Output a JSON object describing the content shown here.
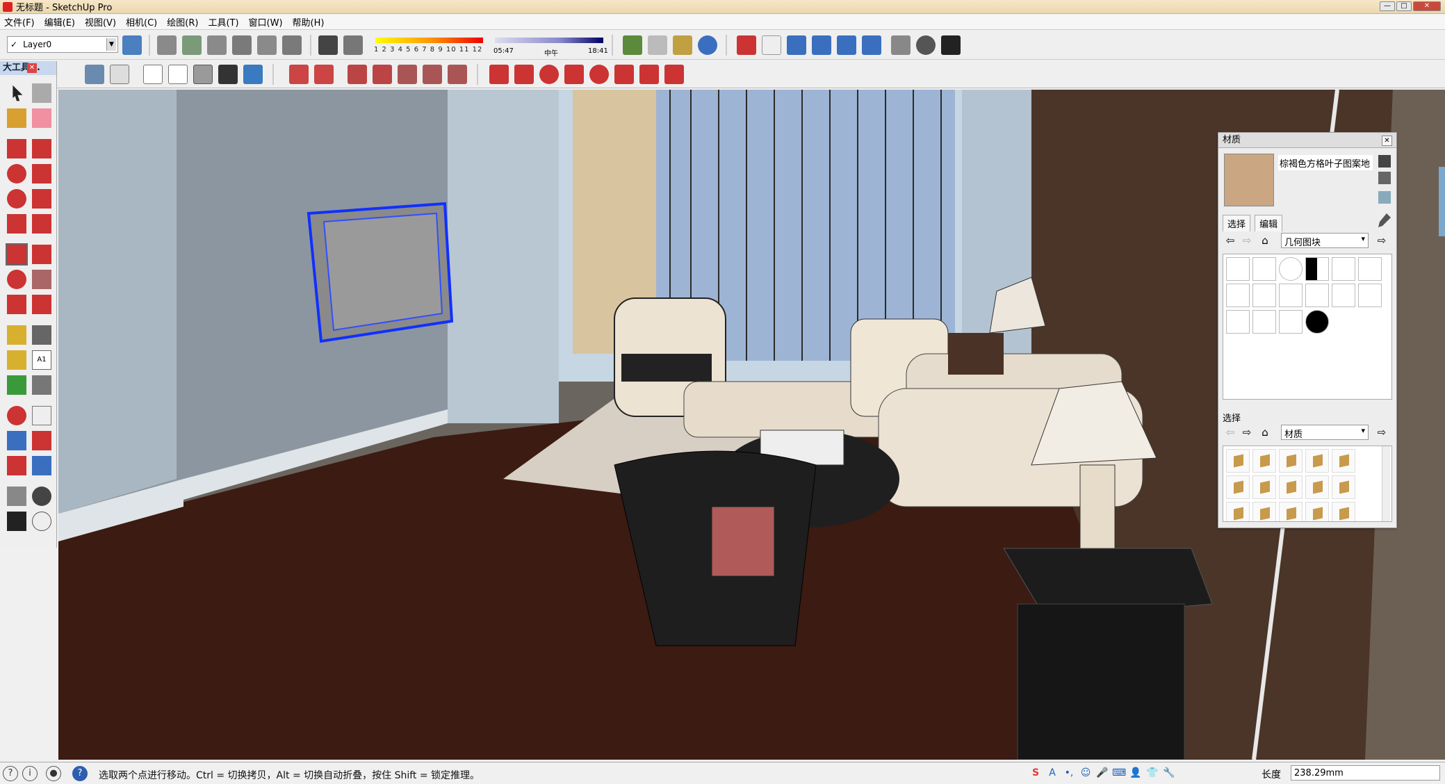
{
  "window": {
    "title": "无标题 - SketchUp Pro"
  },
  "menu": [
    "文件(F)",
    "编辑(E)",
    "视图(V)",
    "相机(C)",
    "绘图(R)",
    "工具(T)",
    "窗口(W)",
    "帮助(H)"
  ],
  "layer": {
    "current": "Layer0"
  },
  "shadow": {
    "month_ticks": "1 2 3 4 5 6 7 8 9 10 11 12",
    "time_start": "05:47",
    "time_mid": "中午",
    "time_end": "18:41"
  },
  "toolpanel": {
    "title": "大工具..."
  },
  "materials": {
    "panel_title": "材质",
    "current_name": "棕褐色方格叶子图案地",
    "tabs": [
      "选择",
      "编辑"
    ],
    "collection1": "几何图块",
    "section2_label": "选择",
    "collection2": "材质",
    "swatch_color": "#caa683"
  },
  "status": {
    "hint": "选取两个点进行移动。Ctrl = 切换拷贝，Alt = 切换自动折叠，按住 Shift = 锁定推理。",
    "measure_label": "长度",
    "measure_value": "238.29mm"
  }
}
